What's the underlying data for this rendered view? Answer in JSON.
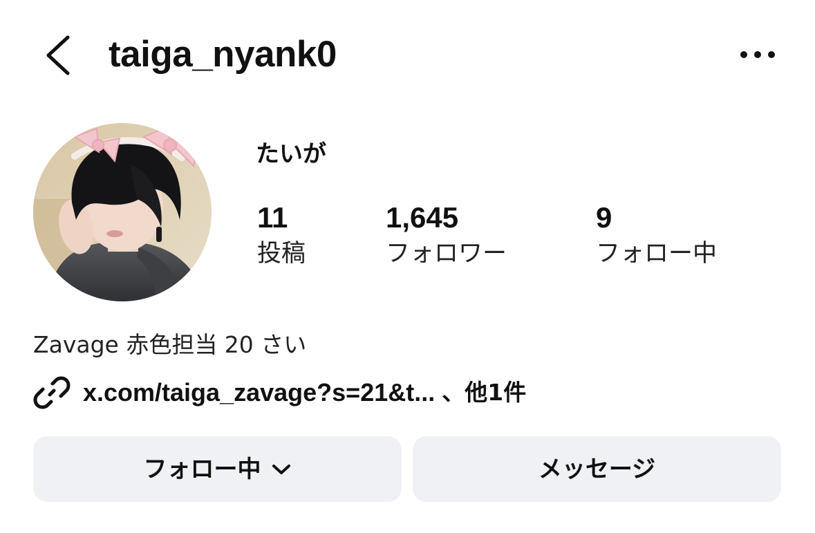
{
  "header": {
    "username": "taiga_nyank0",
    "back_icon": "chevron-left-icon",
    "more_icon": "more-horizontal-icon"
  },
  "profile": {
    "display_name": "たいが",
    "avatar_alt": "profile-photo"
  },
  "stats": {
    "posts": {
      "count": "11",
      "label": "投稿"
    },
    "followers": {
      "count": "1,645",
      "label": "フォロワー"
    },
    "following": {
      "count": "9",
      "label": "フォロー中"
    }
  },
  "bio": {
    "text": "Zavage 赤色担当 20 さい",
    "link_text": "x.com/taiga_zavage?s=21&t...",
    "link_more": "、他1件",
    "link_icon": "link-icon"
  },
  "actions": {
    "following_label": "フォロー中",
    "following_icon": "chevron-down-icon",
    "message_label": "メッセージ"
  },
  "colors": {
    "text": "#111111",
    "button_bg": "#eff1f4",
    "background": "#ffffff"
  }
}
